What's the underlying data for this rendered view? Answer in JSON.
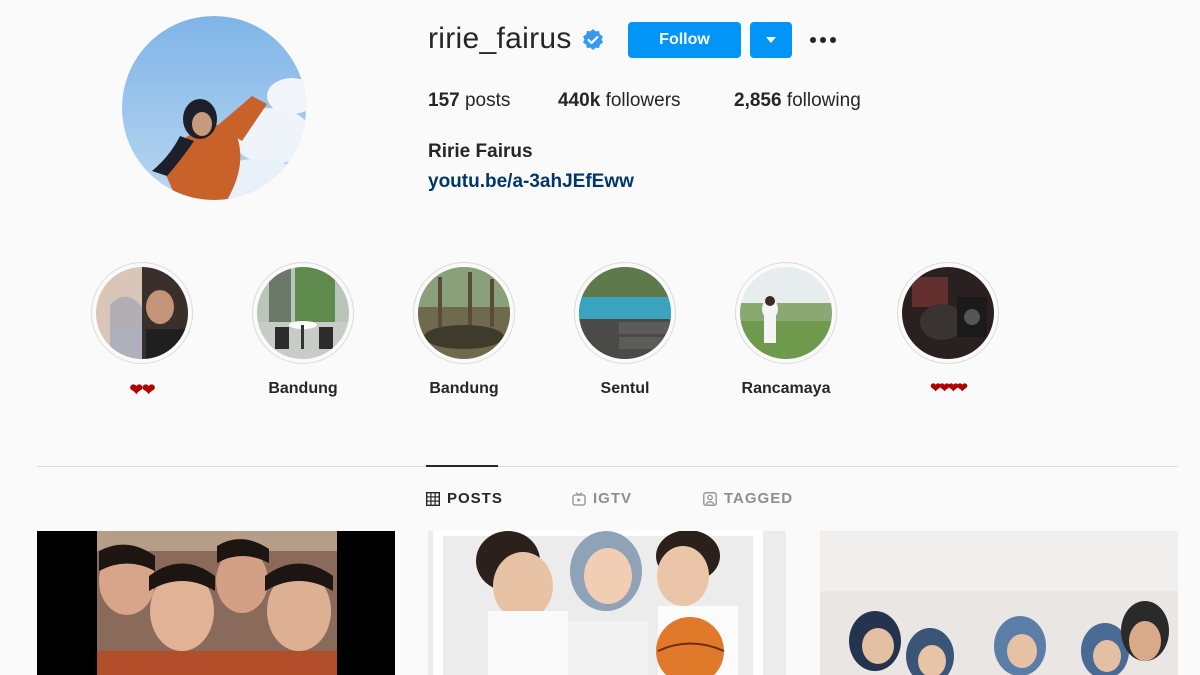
{
  "profile": {
    "username": "ririe_fairus",
    "verified": true,
    "follow_label": "Follow",
    "stats": {
      "posts": "157",
      "posts_label": "posts",
      "followers": "440k",
      "followers_label": "followers",
      "following": "2,856",
      "following_label": "following"
    },
    "full_name": "Ririe Fairus",
    "link": "youtu.be/a-3ahJEfEww"
  },
  "highlights": [
    {
      "label": "❤❤"
    },
    {
      "label": "Bandung"
    },
    {
      "label": "Bandung"
    },
    {
      "label": "Sentul"
    },
    {
      "label": "Rancamaya"
    },
    {
      "label": "❤❤❤❤"
    }
  ],
  "tabs": [
    {
      "label": "POSTS",
      "icon": "grid-icon",
      "active": true
    },
    {
      "label": "IGTV",
      "icon": "igtv-icon",
      "active": false
    },
    {
      "label": "TAGGED",
      "icon": "tagged-icon",
      "active": false
    }
  ],
  "colors": {
    "accent": "#0095f6",
    "link": "#00376b",
    "background": "#fafafa",
    "heart": "#b00000"
  }
}
